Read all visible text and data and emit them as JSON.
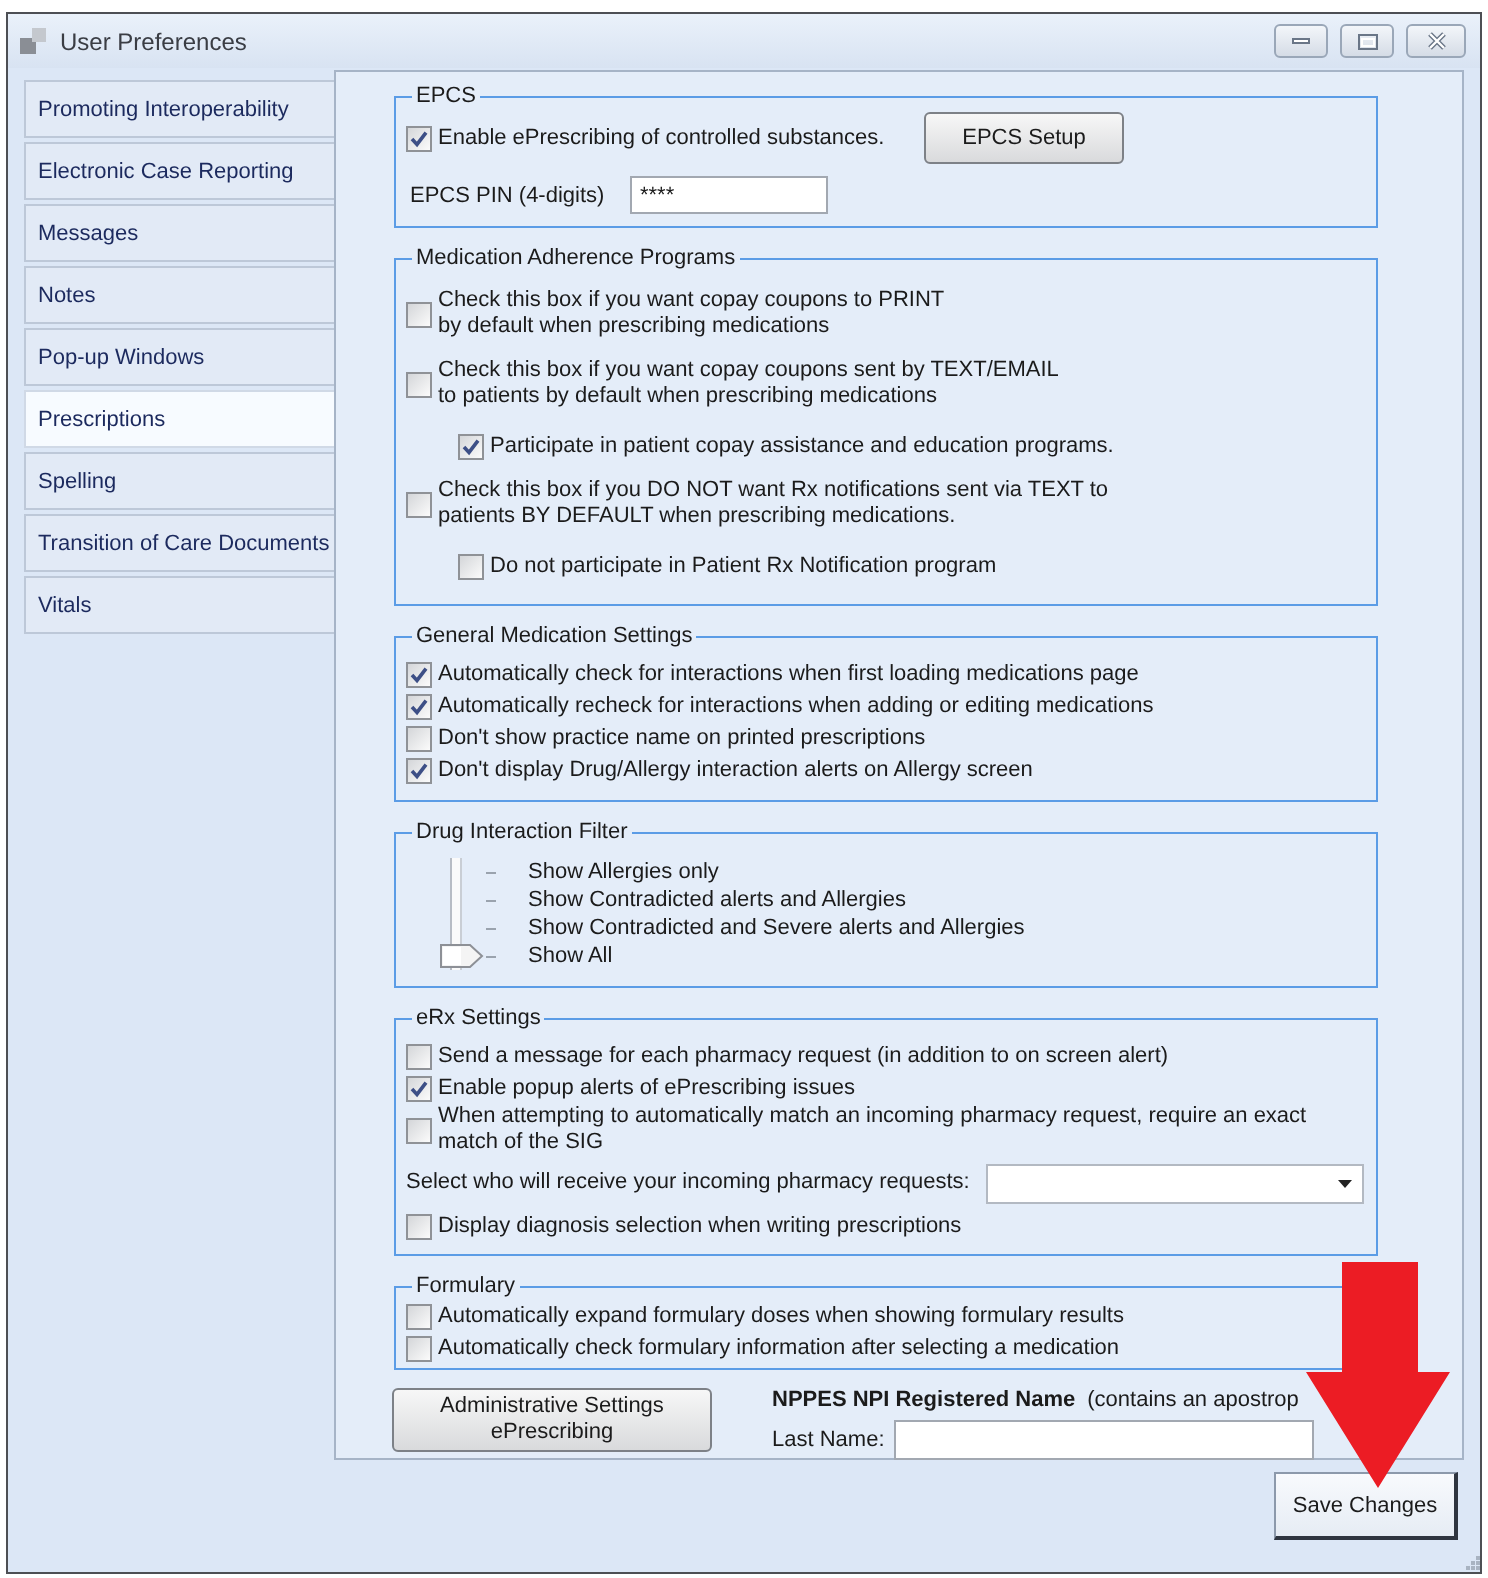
{
  "window": {
    "title": "User Preferences"
  },
  "sidebar": {
    "items": [
      {
        "label": "Promoting Interoperability",
        "selected": false
      },
      {
        "label": "Electronic Case Reporting",
        "selected": false
      },
      {
        "label": "Messages",
        "selected": false
      },
      {
        "label": "Notes",
        "selected": false
      },
      {
        "label": "Pop-up Windows",
        "selected": false
      },
      {
        "label": "Prescriptions",
        "selected": true
      },
      {
        "label": "Spelling",
        "selected": false
      },
      {
        "label": "Transition of Care Documents",
        "selected": false
      },
      {
        "label": "Vitals",
        "selected": false
      }
    ]
  },
  "epcs": {
    "title": "EPCS",
    "enable": {
      "label": "Enable ePrescribing of controlled substances.",
      "checked": true
    },
    "setup_button": "EPCS Setup",
    "pin": {
      "label": "EPCS PIN (4-digits)",
      "value": "****"
    }
  },
  "medication_adherence": {
    "title": "Medication Adherence Programs",
    "options": [
      {
        "label": "Check this box if you want copay coupons to PRINT\nby default when prescribing medications",
        "checked": false
      },
      {
        "label": "Check this box if you want copay coupons sent by TEXT/EMAIL\nto patients by default when prescribing medications",
        "checked": false,
        "children": [
          {
            "label": "Participate in patient copay assistance and education programs.",
            "checked": true
          }
        ]
      },
      {
        "label": "Check this box if you DO NOT want Rx notifications sent via TEXT to\npatients BY DEFAULT when prescribing medications.",
        "checked": false,
        "children": [
          {
            "label": "Do not participate in Patient Rx Notification program",
            "checked": false
          }
        ]
      }
    ]
  },
  "general_medication": {
    "title": "General Medication Settings",
    "options": [
      {
        "label": "Automatically check for interactions when first loading medications page",
        "checked": true
      },
      {
        "label": "Automatically recheck for interactions when adding or editing medications",
        "checked": true
      },
      {
        "label": "Don't show practice name on printed prescriptions",
        "checked": false
      },
      {
        "label": "Don't display Drug/Allergy interaction alerts on Allergy screen",
        "checked": true
      }
    ]
  },
  "drug_interaction_filter": {
    "title": "Drug Interaction Filter",
    "options": [
      {
        "label": "Show Allergies only",
        "selected": false
      },
      {
        "label": "Show Contradicted alerts and Allergies",
        "selected": false
      },
      {
        "label": "Show Contradicted and Severe alerts and Allergies",
        "selected": false
      },
      {
        "label": "Show All",
        "selected": true
      }
    ]
  },
  "erx": {
    "title": "eRx Settings",
    "items": [
      {
        "kind": "checkbox",
        "label": "Send a message for each pharmacy request (in addition to on screen alert)",
        "checked": false
      },
      {
        "kind": "checkbox",
        "label": "Enable popup alerts of ePrescribing issues",
        "checked": true
      },
      {
        "kind": "checkbox",
        "label": "When attempting to automatically match an incoming pharmacy request, require an exact match of the SIG",
        "checked": false
      },
      {
        "kind": "dropdown",
        "label": "Select who will receive your incoming pharmacy requests:"
      },
      {
        "kind": "checkbox",
        "label": "Display diagnosis selection when writing prescriptions",
        "checked": false
      }
    ]
  },
  "formulary": {
    "title": "Formulary",
    "options": [
      {
        "label": "Automatically expand formulary doses when showing formulary results",
        "checked": false
      },
      {
        "label": "Automatically check formulary information after selecting a medication",
        "checked": false
      }
    ]
  },
  "admin_button": "Administrative Settings\nePrescribing",
  "npi": {
    "title": "NPPES NPI Registered Name",
    "note": "(contains an apostrop",
    "last_name_label": "Last Name:"
  },
  "save_button": "Save Changes"
}
